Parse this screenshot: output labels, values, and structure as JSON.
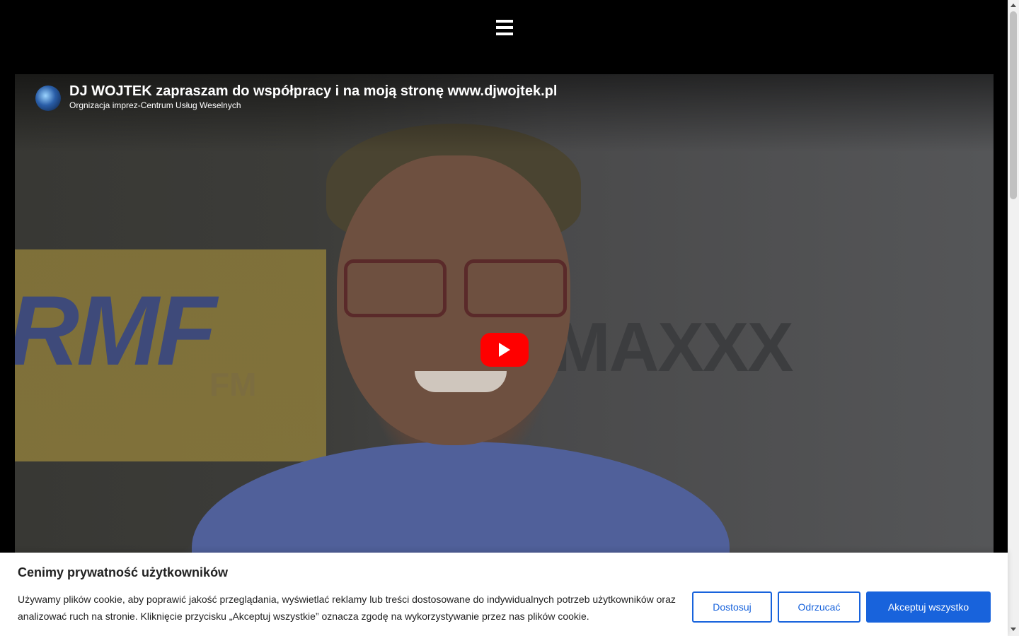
{
  "header": {
    "menu_icon": "hamburger-menu-icon"
  },
  "video": {
    "title": "DJ WOJTEK zapraszam do współpracy i na moją stronę www.djwojtek.pl",
    "channel": "Orgnizacja imprez-Centrum Usług Weselnych",
    "play_icon": "play-icon",
    "play_color": "#ff0000",
    "background_texts": {
      "rmf": "RMF",
      "fm": "FM",
      "maxxx": "MAXXX"
    }
  },
  "cookie_banner": {
    "title": "Cenimy prywatność użytkowników",
    "text": "Używamy plików cookie, aby poprawić jakość przeglądania, wyświetlać reklamy lub treści dostosowane do indywidualnych potrzeb użytkowników oraz analizować ruch na stronie. Kliknięcie przycisku „Akceptuj wszystkie” oznacza zgodę na wykorzystywanie przez nas plików cookie.",
    "buttons": {
      "customize": "Dostosuj",
      "reject": "Odrzucać",
      "accept": "Akceptuj wszystko"
    },
    "accent_color": "#1863dc"
  }
}
